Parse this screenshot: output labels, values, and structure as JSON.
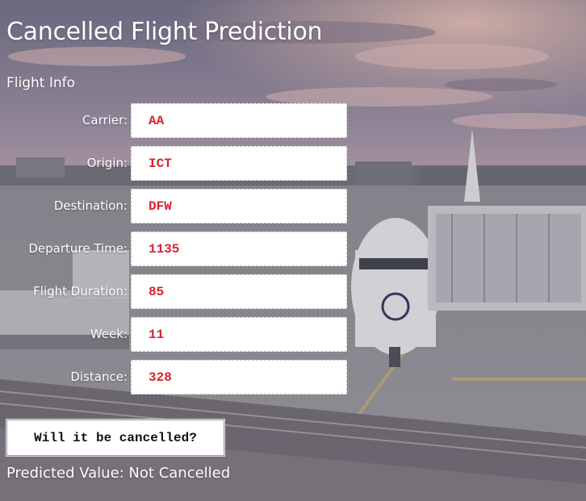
{
  "page": {
    "title": "Cancelled Flight Prediction",
    "section_title": "Flight Info"
  },
  "form": {
    "fields": [
      {
        "label": "Carrier:",
        "value": "AA"
      },
      {
        "label": "Origin:",
        "value": "ICT"
      },
      {
        "label": "Destination:",
        "value": "DFW"
      },
      {
        "label": "Departure Time:",
        "value": "1135"
      },
      {
        "label": "Flight Duration:",
        "value": "85"
      },
      {
        "label": "Week:",
        "value": "11"
      },
      {
        "label": "Distance:",
        "value": "328"
      }
    ],
    "submit_label": "Will it be cancelled?"
  },
  "result": {
    "text": "Predicted Value: Not Cancelled"
  },
  "colors": {
    "input_text": "#d9232f",
    "label_text": "#ffffff"
  },
  "background": {
    "description_icon": "airport-apron-photo"
  }
}
